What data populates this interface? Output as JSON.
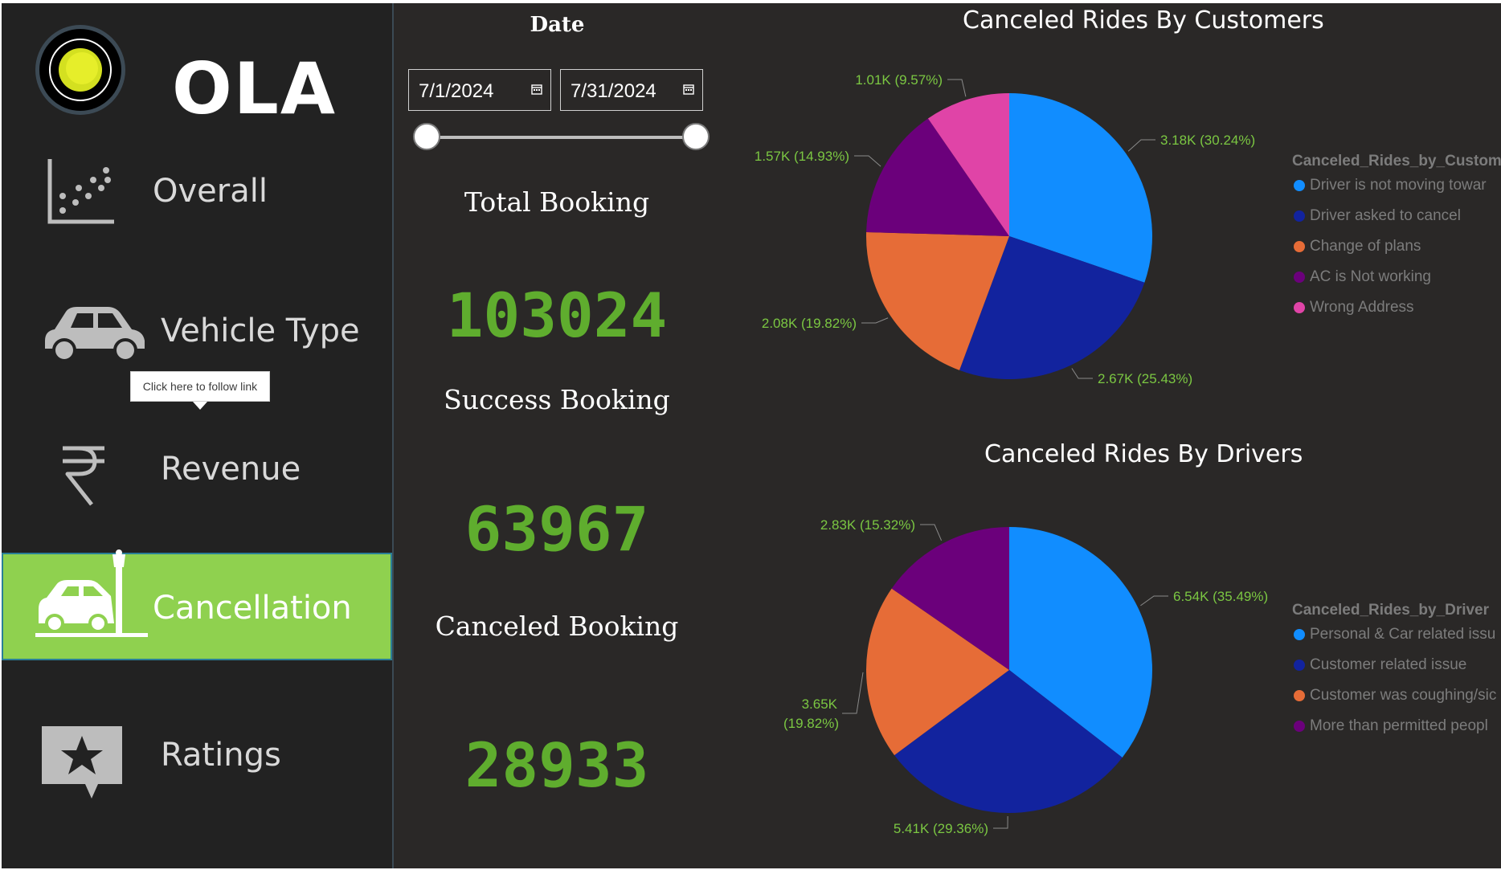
{
  "brand": {
    "logo_text": "OLA"
  },
  "nav": {
    "overall": "Overall",
    "vehicle_type": "Vehicle Type",
    "revenue": "Revenue",
    "cancellation": "Cancellation",
    "ratings": "Ratings",
    "tooltip": "Click here to follow link"
  },
  "date_filter": {
    "title": "Date",
    "start": "7/1/2024",
    "end": "7/31/2024"
  },
  "kpis": {
    "total_label": "Total Booking",
    "total_value": "103024",
    "success_label": "Success Booking",
    "success_value": "63967",
    "canceled_label": "Canceled Booking",
    "canceled_value": "28933"
  },
  "colors": {
    "accent_green": "#8fd14f",
    "kpi_green": "#5fad2e",
    "label_green": "#7bc742",
    "slice_blue": "#118dff",
    "slice_darkblue": "#12239e",
    "slice_orange": "#e66c37",
    "slice_purple": "#6b007b",
    "slice_pink": "#e044a7"
  },
  "chart_data": [
    {
      "type": "pie",
      "title": "Canceled Rides By Customers",
      "legend_title": "Canceled_Rides_by_Custome",
      "legend_placement": "right",
      "slices": [
        {
          "name": "Driver is not moving towar",
          "value": 3180,
          "label": "3.18K (30.24%)",
          "color": "#118dff"
        },
        {
          "name": "Driver asked to cancel",
          "value": 2670,
          "label": "2.67K (25.43%)",
          "color": "#12239e"
        },
        {
          "name": "Change of plans",
          "value": 2080,
          "label": "2.08K (19.82%)",
          "color": "#e66c37"
        },
        {
          "name": "AC is Not working",
          "value": 1570,
          "label": "1.57K (14.93%)",
          "color": "#6b007b"
        },
        {
          "name": "Wrong Address",
          "value": 1010,
          "label": "1.01K (9.57%)",
          "color": "#e044a7"
        }
      ]
    },
    {
      "type": "pie",
      "title": "Canceled Rides By Drivers",
      "legend_title": "Canceled_Rides_by_Driver",
      "legend_placement": "right",
      "slices": [
        {
          "name": "Personal & Car related issu",
          "value": 6540,
          "label": "6.54K (35.49%)",
          "color": "#118dff"
        },
        {
          "name": "Customer related issue",
          "value": 5410,
          "label": "5.41K (29.36%)",
          "color": "#12239e"
        },
        {
          "name": "Customer was coughing/sic",
          "value": 3650,
          "label": "3.65K (19.82%)",
          "color": "#e66c37"
        },
        {
          "name": "More than permitted peopl",
          "value": 2830,
          "label": "2.83K (15.32%)",
          "color": "#6b007b"
        }
      ]
    }
  ]
}
